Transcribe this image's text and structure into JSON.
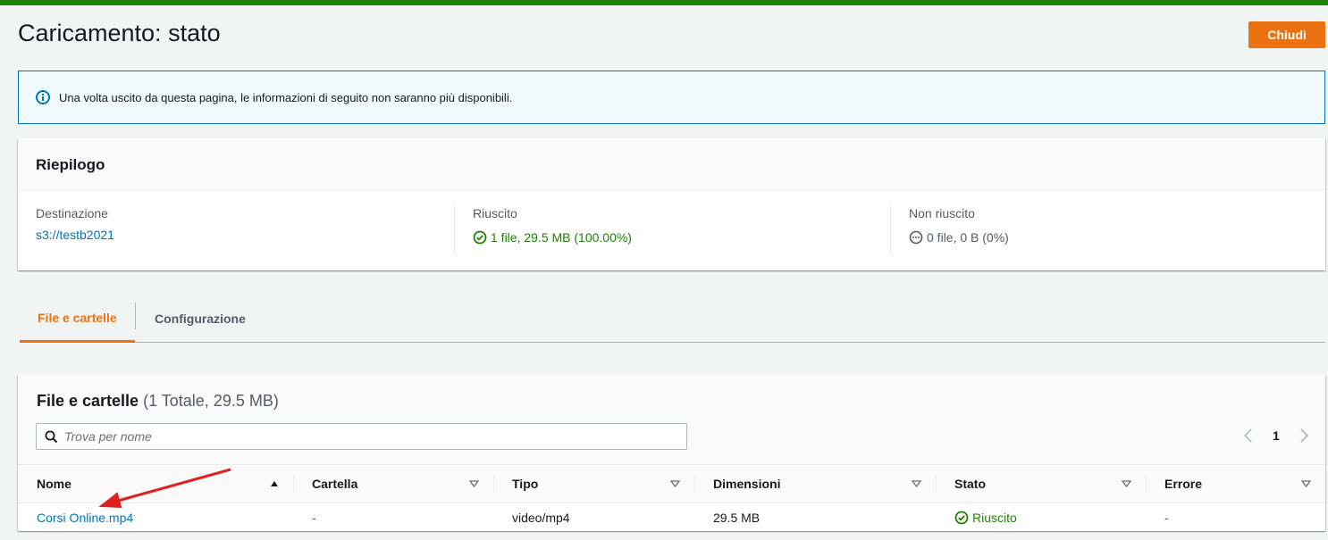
{
  "header": {
    "title": "Caricamento: stato",
    "close_label": "Chiudi"
  },
  "alert": {
    "message": "Una volta uscito da questa pagina, le informazioni di seguito non saranno più disponibili."
  },
  "summary": {
    "title": "Riepilogo",
    "destination": {
      "label": "Destinazione",
      "value": "s3://testb2021"
    },
    "succeeded": {
      "label": "Riuscito",
      "value": "1 file, 29.5 MB (100.00%)"
    },
    "failed": {
      "label": "Non riuscito",
      "value": "0 file, 0 B (0%)"
    }
  },
  "tabs": [
    {
      "label": "File e cartelle",
      "active": true
    },
    {
      "label": "Configurazione",
      "active": false
    }
  ],
  "files": {
    "title": "File e cartelle",
    "count": "(1 Totale, 29.5 MB)",
    "search_placeholder": "Trova per nome",
    "page": "1",
    "columns": [
      "Nome",
      "Cartella",
      "Tipo",
      "Dimensioni",
      "Stato",
      "Errore"
    ],
    "rows": [
      {
        "name": "Corsi Online.mp4",
        "folder": "-",
        "type": "video/mp4",
        "size": "29.5 MB",
        "status": "Riuscito",
        "error": "-"
      }
    ]
  },
  "colors": {
    "accent": "#ec7211",
    "success": "#1d8102",
    "link": "#0073bb",
    "annotation_arrow": "#e02020"
  },
  "icons": [
    "info-icon",
    "check-circle-icon",
    "ellipsis-circle-icon",
    "search-icon",
    "chevron-left-icon",
    "chevron-right-icon",
    "sort-asc-icon",
    "sort-desc-icon",
    "annotation-arrow"
  ]
}
